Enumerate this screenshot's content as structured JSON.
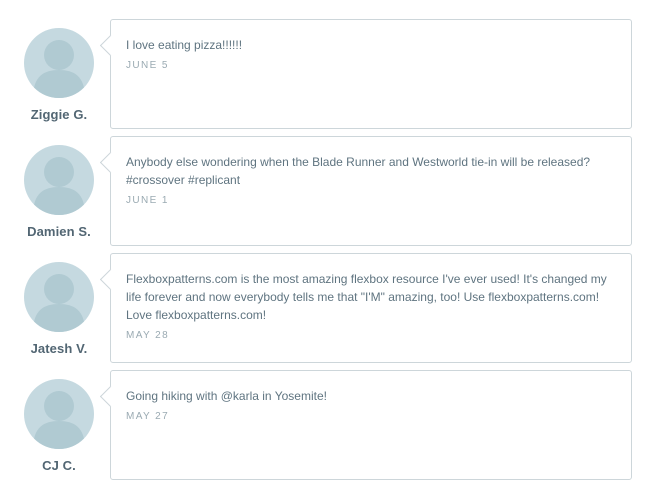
{
  "comments": [
    {
      "author": "Ziggie G.",
      "message": "I love eating pizza!!!!!!",
      "date": "JUNE 5"
    },
    {
      "author": "Damien S.",
      "message": "Anybody else wondering when the Blade Runner and Westworld tie-in will be released? #crossover #replicant",
      "date": "JUNE 1"
    },
    {
      "author": "Jatesh V.",
      "message": "Flexboxpatterns.com is the most amazing flexbox resource I've ever used! It's changed my life forever and now everybody tells me that \"I'M\" amazing, too! Use flexboxpatterns.com! Love flexboxpatterns.com!",
      "date": "MAY 28"
    },
    {
      "author": "CJ C.",
      "message": "Going hiking with @karla in Yosemite!",
      "date": "MAY 27"
    }
  ],
  "colors": {
    "avatar_background": "#c5d9e0",
    "avatar_figure": "#b3ccd4",
    "border": "#cdd6da",
    "text": "#5f7480",
    "date": "#9aaab2"
  },
  "icons": {
    "avatar": "person-silhouette-icon"
  }
}
